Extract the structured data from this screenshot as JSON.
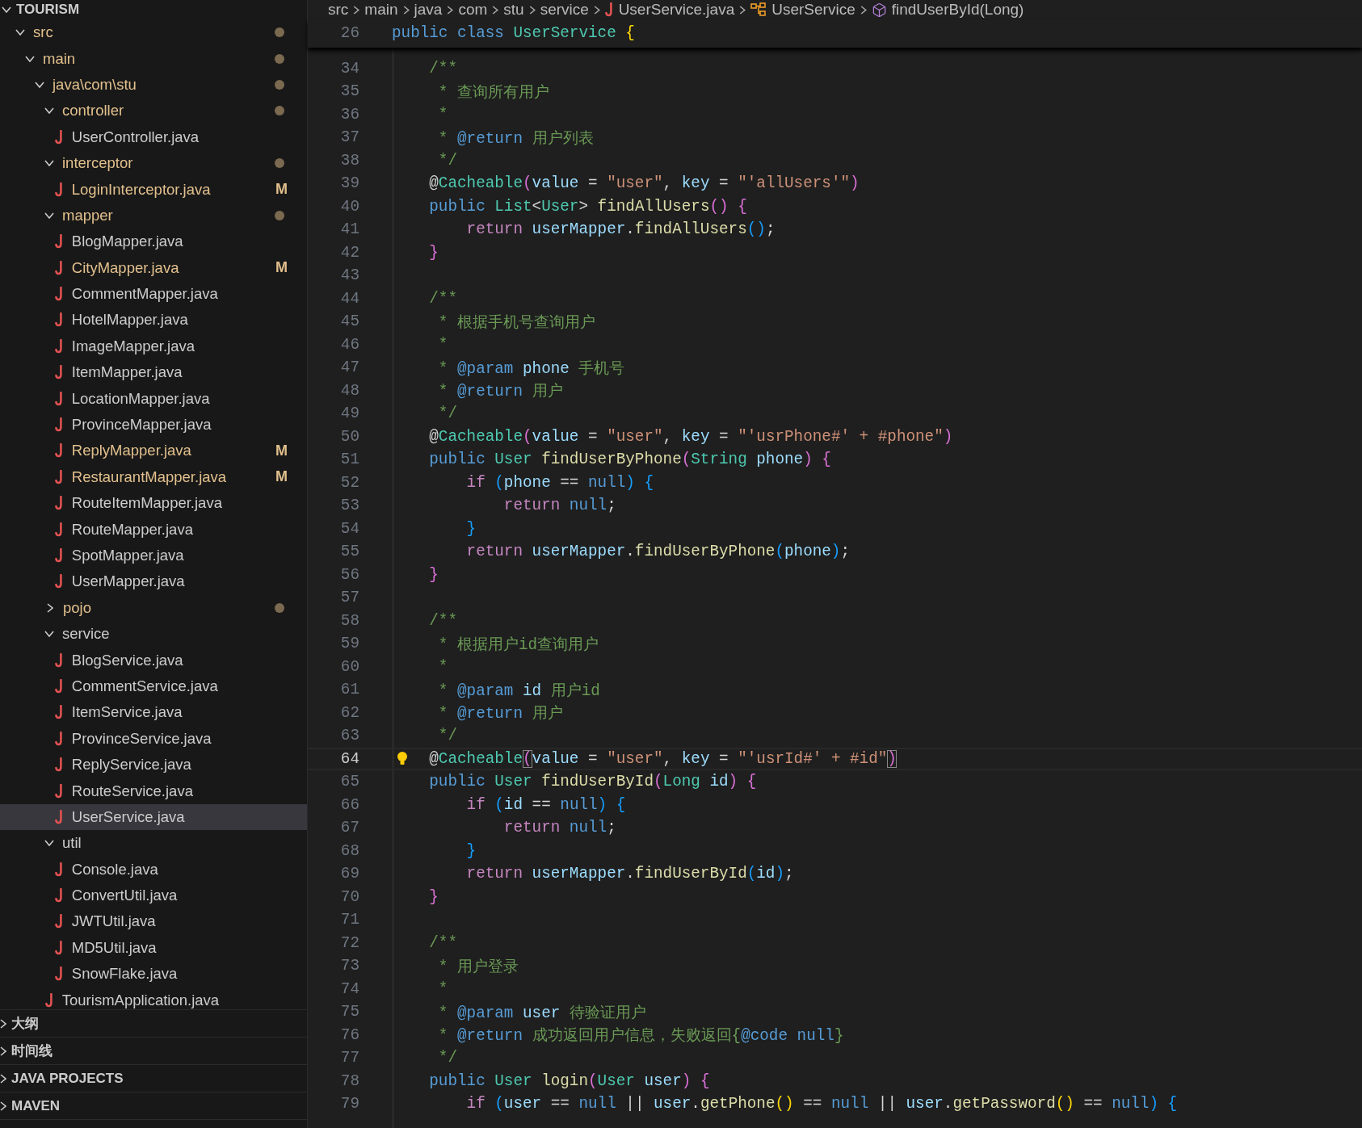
{
  "explorer": {
    "title": "TOURISM",
    "expanded": true,
    "tree": [
      {
        "label": "src",
        "kind": "folder",
        "expanded": true,
        "modified": true,
        "selected": false,
        "children": [
          {
            "label": "main",
            "kind": "folder",
            "expanded": true,
            "modified": true,
            "selected": false,
            "children": [
              {
                "label": "java\\com\\stu",
                "kind": "folder",
                "expanded": true,
                "modified": true,
                "selected": false,
                "children": [
                  {
                    "label": "controller",
                    "kind": "folder",
                    "expanded": true,
                    "modified": true,
                    "selected": false,
                    "children": [
                      {
                        "label": "UserController.java",
                        "kind": "file",
                        "modified": false,
                        "selected": false
                      }
                    ]
                  },
                  {
                    "label": "interceptor",
                    "kind": "folder",
                    "expanded": true,
                    "modified": true,
                    "selected": false,
                    "children": [
                      {
                        "label": "LoginInterceptor.java",
                        "kind": "file",
                        "modified": true,
                        "badge": "M",
                        "selected": false
                      }
                    ]
                  },
                  {
                    "label": "mapper",
                    "kind": "folder",
                    "expanded": true,
                    "modified": true,
                    "selected": false,
                    "children": [
                      {
                        "label": "BlogMapper.java",
                        "kind": "file",
                        "modified": false,
                        "selected": false
                      },
                      {
                        "label": "CityMapper.java",
                        "kind": "file",
                        "modified": true,
                        "badge": "M",
                        "selected": false
                      },
                      {
                        "label": "CommentMapper.java",
                        "kind": "file",
                        "modified": false,
                        "selected": false
                      },
                      {
                        "label": "HotelMapper.java",
                        "kind": "file",
                        "modified": false,
                        "selected": false
                      },
                      {
                        "label": "ImageMapper.java",
                        "kind": "file",
                        "modified": false,
                        "selected": false
                      },
                      {
                        "label": "ItemMapper.java",
                        "kind": "file",
                        "modified": false,
                        "selected": false
                      },
                      {
                        "label": "LocationMapper.java",
                        "kind": "file",
                        "modified": false,
                        "selected": false
                      },
                      {
                        "label": "ProvinceMapper.java",
                        "kind": "file",
                        "modified": false,
                        "selected": false
                      },
                      {
                        "label": "ReplyMapper.java",
                        "kind": "file",
                        "modified": true,
                        "badge": "M",
                        "selected": false
                      },
                      {
                        "label": "RestaurantMapper.java",
                        "kind": "file",
                        "modified": true,
                        "badge": "M",
                        "selected": false
                      },
                      {
                        "label": "RouteItemMapper.java",
                        "kind": "file",
                        "modified": false,
                        "selected": false
                      },
                      {
                        "label": "RouteMapper.java",
                        "kind": "file",
                        "modified": false,
                        "selected": false
                      },
                      {
                        "label": "SpotMapper.java",
                        "kind": "file",
                        "modified": false,
                        "selected": false
                      },
                      {
                        "label": "UserMapper.java",
                        "kind": "file",
                        "modified": false,
                        "selected": false
                      }
                    ]
                  },
                  {
                    "label": "pojo",
                    "kind": "folder",
                    "expanded": false,
                    "modified": true,
                    "selected": false
                  },
                  {
                    "label": "service",
                    "kind": "folder",
                    "expanded": true,
                    "modified": false,
                    "selected": false,
                    "children": [
                      {
                        "label": "BlogService.java",
                        "kind": "file",
                        "modified": false,
                        "selected": false
                      },
                      {
                        "label": "CommentService.java",
                        "kind": "file",
                        "modified": false,
                        "selected": false
                      },
                      {
                        "label": "ItemService.java",
                        "kind": "file",
                        "modified": false,
                        "selected": false
                      },
                      {
                        "label": "ProvinceService.java",
                        "kind": "file",
                        "modified": false,
                        "selected": false
                      },
                      {
                        "label": "ReplyService.java",
                        "kind": "file",
                        "modified": false,
                        "selected": false
                      },
                      {
                        "label": "RouteService.java",
                        "kind": "file",
                        "modified": false,
                        "selected": false
                      },
                      {
                        "label": "UserService.java",
                        "kind": "file",
                        "modified": false,
                        "selected": true
                      }
                    ]
                  },
                  {
                    "label": "util",
                    "kind": "folder",
                    "expanded": true,
                    "modified": false,
                    "selected": false,
                    "children": [
                      {
                        "label": "Console.java",
                        "kind": "file",
                        "modified": false,
                        "selected": false
                      },
                      {
                        "label": "ConvertUtil.java",
                        "kind": "file",
                        "modified": false,
                        "selected": false
                      },
                      {
                        "label": "JWTUtil.java",
                        "kind": "file",
                        "modified": false,
                        "selected": false
                      },
                      {
                        "label": "MD5Util.java",
                        "kind": "file",
                        "modified": false,
                        "selected": false
                      },
                      {
                        "label": "SnowFlake.java",
                        "kind": "file",
                        "modified": false,
                        "selected": false
                      }
                    ]
                  },
                  {
                    "label": "TourismApplication.java",
                    "kind": "file",
                    "modified": false,
                    "selected": false
                  }
                ]
              }
            ]
          }
        ]
      }
    ]
  },
  "panels": [
    {
      "label": "大纲",
      "expanded": false
    },
    {
      "label": "时间线",
      "expanded": false
    },
    {
      "label": "JAVA PROJECTS",
      "expanded": false
    },
    {
      "label": "MAVEN",
      "expanded": false
    }
  ],
  "breadcrumbs": [
    {
      "label": "src",
      "kind": "folder"
    },
    {
      "label": "main",
      "kind": "folder"
    },
    {
      "label": "java",
      "kind": "folder"
    },
    {
      "label": "com",
      "kind": "folder"
    },
    {
      "label": "stu",
      "kind": "folder"
    },
    {
      "label": "service",
      "kind": "folder"
    },
    {
      "label": "UserService.java",
      "kind": "java-file"
    },
    {
      "label": "UserService",
      "kind": "class"
    },
    {
      "label": "findUserById(Long)",
      "kind": "method"
    }
  ],
  "sticky_line": {
    "number": "26",
    "tokens": [
      {
        "kind": "keyword",
        "text": "public class "
      },
      {
        "kind": "type",
        "text": "UserService "
      },
      {
        "kind": "bracket-1",
        "text": "{"
      }
    ]
  },
  "lines": [
    {
      "number": "34",
      "current": false,
      "tokens": [
        {
          "kind": "comment",
          "text": "    /**"
        }
      ]
    },
    {
      "number": "35",
      "current": false,
      "tokens": [
        {
          "kind": "comment",
          "text": "     * 查询所有用户"
        }
      ]
    },
    {
      "number": "36",
      "current": false,
      "tokens": [
        {
          "kind": "comment",
          "text": "     *"
        }
      ]
    },
    {
      "number": "37",
      "current": false,
      "tokens": [
        {
          "kind": "comment",
          "text": "     * "
        },
        {
          "kind": "doc-tag",
          "text": "@return"
        },
        {
          "kind": "comment",
          "text": " 用户列表"
        }
      ]
    },
    {
      "number": "38",
      "current": false,
      "tokens": [
        {
          "kind": "comment",
          "text": "     */"
        }
      ]
    },
    {
      "number": "39",
      "current": false,
      "tokens": [
        {
          "kind": "plain",
          "text": "    @"
        },
        {
          "kind": "type",
          "text": "Cacheable"
        },
        {
          "kind": "bracket-2",
          "text": "("
        },
        {
          "kind": "variable",
          "text": "value"
        },
        {
          "kind": "plain",
          "text": " = "
        },
        {
          "kind": "string",
          "text": "\"user\""
        },
        {
          "kind": "plain",
          "text": ", "
        },
        {
          "kind": "variable",
          "text": "key"
        },
        {
          "kind": "plain",
          "text": " = "
        },
        {
          "kind": "string",
          "text": "\"'allUsers'\""
        },
        {
          "kind": "bracket-2",
          "text": ")"
        }
      ]
    },
    {
      "number": "40",
      "current": false,
      "tokens": [
        {
          "kind": "keyword",
          "text": "    public "
        },
        {
          "kind": "type",
          "text": "List"
        },
        {
          "kind": "plain",
          "text": "<"
        },
        {
          "kind": "type",
          "text": "User"
        },
        {
          "kind": "plain",
          "text": "> "
        },
        {
          "kind": "function",
          "text": "findAllUsers"
        },
        {
          "kind": "bracket-2",
          "text": "() {"
        }
      ]
    },
    {
      "number": "41",
      "current": false,
      "tokens": [
        {
          "kind": "control",
          "text": "        return "
        },
        {
          "kind": "variable",
          "text": "userMapper"
        },
        {
          "kind": "plain",
          "text": "."
        },
        {
          "kind": "function",
          "text": "findAllUsers"
        },
        {
          "kind": "bracket-3",
          "text": "()"
        },
        {
          "kind": "plain",
          "text": ";"
        }
      ]
    },
    {
      "number": "42",
      "current": false,
      "tokens": [
        {
          "kind": "bracket-2",
          "text": "    }"
        }
      ]
    },
    {
      "number": "43",
      "current": false
    },
    {
      "number": "44",
      "current": false,
      "tokens": [
        {
          "kind": "comment",
          "text": "    /**"
        }
      ]
    },
    {
      "number": "45",
      "current": false,
      "tokens": [
        {
          "kind": "comment",
          "text": "     * 根据手机号查询用户"
        }
      ]
    },
    {
      "number": "46",
      "current": false,
      "tokens": [
        {
          "kind": "comment",
          "text": "     *"
        }
      ]
    },
    {
      "number": "47",
      "current": false,
      "tokens": [
        {
          "kind": "comment",
          "text": "     * "
        },
        {
          "kind": "doc-tag",
          "text": "@param"
        },
        {
          "kind": "variable",
          "text": " phone"
        },
        {
          "kind": "comment",
          "text": " 手机号"
        }
      ]
    },
    {
      "number": "48",
      "current": false,
      "tokens": [
        {
          "kind": "comment",
          "text": "     * "
        },
        {
          "kind": "doc-tag",
          "text": "@return"
        },
        {
          "kind": "comment",
          "text": " 用户"
        }
      ]
    },
    {
      "number": "49",
      "current": false,
      "tokens": [
        {
          "kind": "comment",
          "text": "     */"
        }
      ]
    },
    {
      "number": "50",
      "current": false,
      "tokens": [
        {
          "kind": "plain",
          "text": "    @"
        },
        {
          "kind": "type",
          "text": "Cacheable"
        },
        {
          "kind": "bracket-2",
          "text": "("
        },
        {
          "kind": "variable",
          "text": "value"
        },
        {
          "kind": "plain",
          "text": " = "
        },
        {
          "kind": "string",
          "text": "\"user\""
        },
        {
          "kind": "plain",
          "text": ", "
        },
        {
          "kind": "variable",
          "text": "key"
        },
        {
          "kind": "plain",
          "text": " = "
        },
        {
          "kind": "string",
          "text": "\"'usrPhone#' + #phone\""
        },
        {
          "kind": "bracket-2",
          "text": ")"
        }
      ]
    },
    {
      "number": "51",
      "current": false,
      "tokens": [
        {
          "kind": "keyword",
          "text": "    public "
        },
        {
          "kind": "type",
          "text": "User "
        },
        {
          "kind": "function",
          "text": "findUserByPhone"
        },
        {
          "kind": "bracket-2",
          "text": "("
        },
        {
          "kind": "type",
          "text": "String "
        },
        {
          "kind": "variable",
          "text": "phone"
        },
        {
          "kind": "bracket-2",
          "text": ") {"
        }
      ]
    },
    {
      "number": "52",
      "current": false,
      "tokens": [
        {
          "kind": "control",
          "text": "        if "
        },
        {
          "kind": "bracket-3",
          "text": "("
        },
        {
          "kind": "variable",
          "text": "phone"
        },
        {
          "kind": "plain",
          "text": " == "
        },
        {
          "kind": "keyword",
          "text": "null"
        },
        {
          "kind": "bracket-3",
          "text": ") {"
        }
      ]
    },
    {
      "number": "53",
      "current": false,
      "tokens": [
        {
          "kind": "control",
          "text": "            return "
        },
        {
          "kind": "keyword",
          "text": "null"
        },
        {
          "kind": "plain",
          "text": ";"
        }
      ]
    },
    {
      "number": "54",
      "current": false,
      "tokens": [
        {
          "kind": "bracket-3",
          "text": "        }"
        }
      ]
    },
    {
      "number": "55",
      "current": false,
      "tokens": [
        {
          "kind": "control",
          "text": "        return "
        },
        {
          "kind": "variable",
          "text": "userMapper"
        },
        {
          "kind": "plain",
          "text": "."
        },
        {
          "kind": "function",
          "text": "findUserByPhone"
        },
        {
          "kind": "bracket-3",
          "text": "("
        },
        {
          "kind": "variable",
          "text": "phone"
        },
        {
          "kind": "bracket-3",
          "text": ")"
        },
        {
          "kind": "plain",
          "text": ";"
        }
      ]
    },
    {
      "number": "56",
      "current": false,
      "tokens": [
        {
          "kind": "bracket-2",
          "text": "    }"
        }
      ]
    },
    {
      "number": "57",
      "current": false
    },
    {
      "number": "58",
      "current": false,
      "tokens": [
        {
          "kind": "comment",
          "text": "    /**"
        }
      ]
    },
    {
      "number": "59",
      "current": false,
      "tokens": [
        {
          "kind": "comment",
          "text": "     * 根据用户id查询用户"
        }
      ]
    },
    {
      "number": "60",
      "current": false,
      "tokens": [
        {
          "kind": "comment",
          "text": "     *"
        }
      ]
    },
    {
      "number": "61",
      "current": false,
      "tokens": [
        {
          "kind": "comment",
          "text": "     * "
        },
        {
          "kind": "doc-tag",
          "text": "@param"
        },
        {
          "kind": "variable",
          "text": " id"
        },
        {
          "kind": "comment",
          "text": " 用户id"
        }
      ]
    },
    {
      "number": "62",
      "current": false,
      "tokens": [
        {
          "kind": "comment",
          "text": "     * "
        },
        {
          "kind": "doc-tag",
          "text": "@return"
        },
        {
          "kind": "comment",
          "text": " 用户"
        }
      ]
    },
    {
      "number": "63",
      "current": false,
      "tokens": [
        {
          "kind": "comment",
          "text": "     */"
        }
      ]
    },
    {
      "number": "64",
      "current": true,
      "tokens": [
        {
          "kind": "plain",
          "text": "    @"
        },
        {
          "kind": "type",
          "text": "Cacheable"
        },
        {
          "kind": "bracket-match",
          "text": "("
        },
        {
          "kind": "variable",
          "text": "value"
        },
        {
          "kind": "plain",
          "text": " = "
        },
        {
          "kind": "string",
          "text": "\"user\""
        },
        {
          "kind": "plain",
          "text": ", "
        },
        {
          "kind": "variable",
          "text": "key"
        },
        {
          "kind": "plain",
          "text": " = "
        },
        {
          "kind": "string",
          "text": "\"'usrId#' + #id\""
        },
        {
          "kind": "bracket-match",
          "text": ")"
        }
      ]
    },
    {
      "number": "65",
      "current": false,
      "tokens": [
        {
          "kind": "keyword",
          "text": "    public "
        },
        {
          "kind": "type",
          "text": "User "
        },
        {
          "kind": "function",
          "text": "findUserById"
        },
        {
          "kind": "bracket-2",
          "text": "("
        },
        {
          "kind": "type",
          "text": "Long "
        },
        {
          "kind": "variable",
          "text": "id"
        },
        {
          "kind": "bracket-2",
          "text": ") {"
        }
      ]
    },
    {
      "number": "66",
      "current": false,
      "tokens": [
        {
          "kind": "control",
          "text": "        if "
        },
        {
          "kind": "bracket-3",
          "text": "("
        },
        {
          "kind": "variable",
          "text": "id"
        },
        {
          "kind": "plain",
          "text": " == "
        },
        {
          "kind": "keyword",
          "text": "null"
        },
        {
          "kind": "bracket-3",
          "text": ") {"
        }
      ]
    },
    {
      "number": "67",
      "current": false,
      "tokens": [
        {
          "kind": "control",
          "text": "            return "
        },
        {
          "kind": "keyword",
          "text": "null"
        },
        {
          "kind": "plain",
          "text": ";"
        }
      ]
    },
    {
      "number": "68",
      "current": false,
      "tokens": [
        {
          "kind": "bracket-3",
          "text": "        }"
        }
      ]
    },
    {
      "number": "69",
      "current": false,
      "tokens": [
        {
          "kind": "control",
          "text": "        return "
        },
        {
          "kind": "variable",
          "text": "userMapper"
        },
        {
          "kind": "plain",
          "text": "."
        },
        {
          "kind": "function",
          "text": "findUserById"
        },
        {
          "kind": "bracket-3",
          "text": "("
        },
        {
          "kind": "variable",
          "text": "id"
        },
        {
          "kind": "bracket-3",
          "text": ")"
        },
        {
          "kind": "plain",
          "text": ";"
        }
      ]
    },
    {
      "number": "70",
      "current": false,
      "tokens": [
        {
          "kind": "bracket-2",
          "text": "    }"
        }
      ]
    },
    {
      "number": "71",
      "current": false
    },
    {
      "number": "72",
      "current": false,
      "tokens": [
        {
          "kind": "comment",
          "text": "    /**"
        }
      ]
    },
    {
      "number": "73",
      "current": false,
      "tokens": [
        {
          "kind": "comment",
          "text": "     * 用户登录"
        }
      ]
    },
    {
      "number": "74",
      "current": false,
      "tokens": [
        {
          "kind": "comment",
          "text": "     *"
        }
      ]
    },
    {
      "number": "75",
      "current": false,
      "tokens": [
        {
          "kind": "comment",
          "text": "     * "
        },
        {
          "kind": "doc-tag",
          "text": "@param"
        },
        {
          "kind": "variable",
          "text": " user"
        },
        {
          "kind": "comment",
          "text": " 待验证用户"
        }
      ]
    },
    {
      "number": "76",
      "current": false,
      "tokens": [
        {
          "kind": "comment",
          "text": "     * "
        },
        {
          "kind": "doc-tag",
          "text": "@return"
        },
        {
          "kind": "comment",
          "text": " 成功返回用户信息，失败返回{"
        },
        {
          "kind": "doc-tag",
          "text": "@code null"
        },
        {
          "kind": "comment",
          "text": "}"
        }
      ]
    },
    {
      "number": "77",
      "current": false,
      "tokens": [
        {
          "kind": "comment",
          "text": "     */"
        }
      ]
    },
    {
      "number": "78",
      "current": false,
      "tokens": [
        {
          "kind": "keyword",
          "text": "    public "
        },
        {
          "kind": "type",
          "text": "User "
        },
        {
          "kind": "function",
          "text": "login"
        },
        {
          "kind": "bracket-2",
          "text": "("
        },
        {
          "kind": "type",
          "text": "User "
        },
        {
          "kind": "variable",
          "text": "user"
        },
        {
          "kind": "bracket-2",
          "text": ") {"
        }
      ]
    },
    {
      "number": "79",
      "current": false,
      "tokens": [
        {
          "kind": "control",
          "text": "        if "
        },
        {
          "kind": "bracket-3",
          "text": "("
        },
        {
          "kind": "variable",
          "text": "user"
        },
        {
          "kind": "plain",
          "text": " == "
        },
        {
          "kind": "keyword",
          "text": "null"
        },
        {
          "kind": "plain",
          "text": " || "
        },
        {
          "kind": "variable",
          "text": "user"
        },
        {
          "kind": "plain",
          "text": "."
        },
        {
          "kind": "function",
          "text": "getPhone"
        },
        {
          "kind": "bracket-1",
          "text": "()"
        },
        {
          "kind": "plain",
          "text": " == "
        },
        {
          "kind": "keyword",
          "text": "null"
        },
        {
          "kind": "plain",
          "text": " || "
        },
        {
          "kind": "variable",
          "text": "user"
        },
        {
          "kind": "plain",
          "text": "."
        },
        {
          "kind": "function",
          "text": "getPassword"
        },
        {
          "kind": "bracket-1",
          "text": "()"
        },
        {
          "kind": "plain",
          "text": " == "
        },
        {
          "kind": "keyword",
          "text": "null"
        },
        {
          "kind": "bracket-3",
          "text": ") {"
        }
      ]
    }
  ]
}
